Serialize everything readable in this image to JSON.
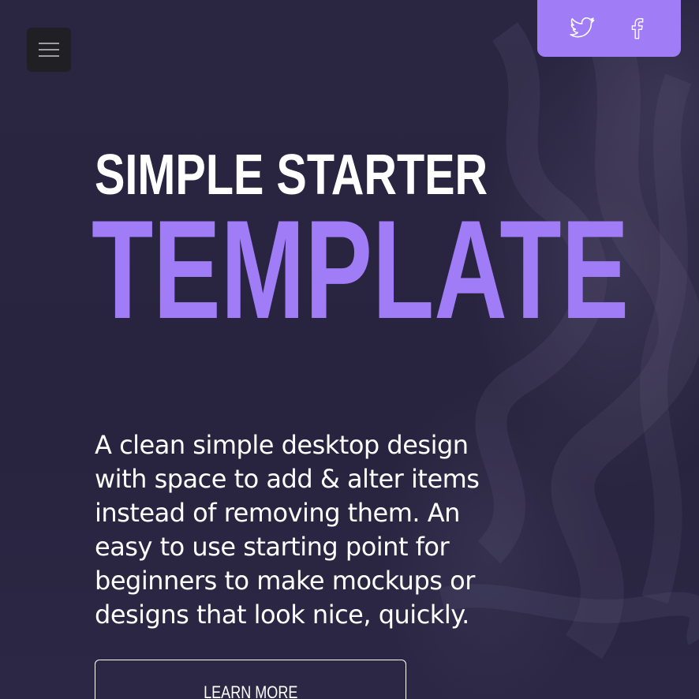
{
  "header": {
    "menu_icon": "hamburger-menu-icon",
    "social": [
      {
        "name": "twitter",
        "icon": "twitter-bird-icon"
      },
      {
        "name": "facebook",
        "icon": "facebook-f-icon"
      }
    ]
  },
  "hero": {
    "title_top": "SIMPLE STARTER",
    "title_main": "TEMPLATE",
    "description": "A clean simple desktop design with space to add & alter items instead of removing them. An easy to use starting point for beginners to make mockups or designs that look nice, quickly.",
    "cta_label": "LEARN MORE"
  },
  "colors": {
    "background": "#27233f",
    "accent": "#a07cf7",
    "menu_button": "#1f1f24",
    "text": "#ffffff"
  }
}
